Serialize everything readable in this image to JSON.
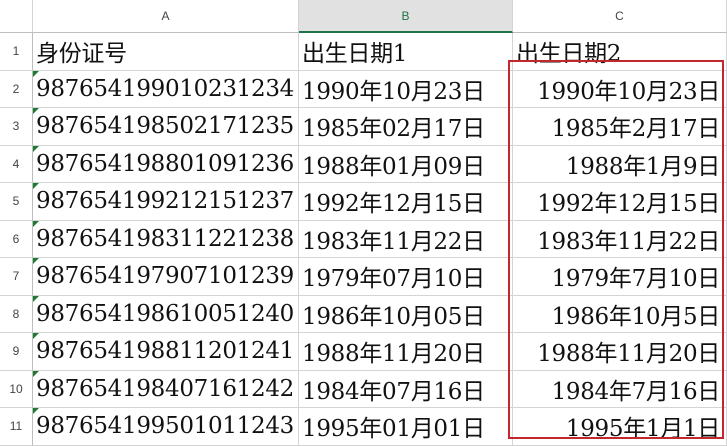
{
  "columns": [
    {
      "letter": "A"
    },
    {
      "letter": "B"
    },
    {
      "letter": "C"
    }
  ],
  "rows": [
    {
      "num": "1",
      "a": "身份证号",
      "b": "出生日期1",
      "c": "出生日期2"
    },
    {
      "num": "2",
      "a": "98765419901023​1234",
      "b": "1990年10月23日",
      "c": "1990年10月23日"
    },
    {
      "num": "3",
      "a": "987654198502171235",
      "b": "1985年02月17日",
      "c": "1985年2月17日"
    },
    {
      "num": "4",
      "a": "987654198801091236",
      "b": "1988年01月09日",
      "c": "1988年1月9日"
    },
    {
      "num": "5",
      "a": "987654199212151237",
      "b": "1992年12月15日",
      "c": "1992年12月15日"
    },
    {
      "num": "6",
      "a": "987654198311221238",
      "b": "1983年11月22日",
      "c": "1983年11月22日"
    },
    {
      "num": "7",
      "a": "987654197907101239",
      "b": "1979年07月10日",
      "c": "1979年7月10日"
    },
    {
      "num": "8",
      "a": "987654198610051240",
      "b": "1986年10月05日",
      "c": "1986年10月5日"
    },
    {
      "num": "9",
      "a": "987654198811201241",
      "b": "1988年11月20日",
      "c": "1988年11月20日"
    },
    {
      "num": "10",
      "a": "987654198407161242",
      "b": "1984年07月16日",
      "c": "1984年7月16日"
    },
    {
      "num": "11",
      "a": "987654199501011243",
      "b": "1995年01月01日",
      "c": "1995年1月1日"
    }
  ],
  "active_column": "B",
  "highlight_color": "#c1272d"
}
